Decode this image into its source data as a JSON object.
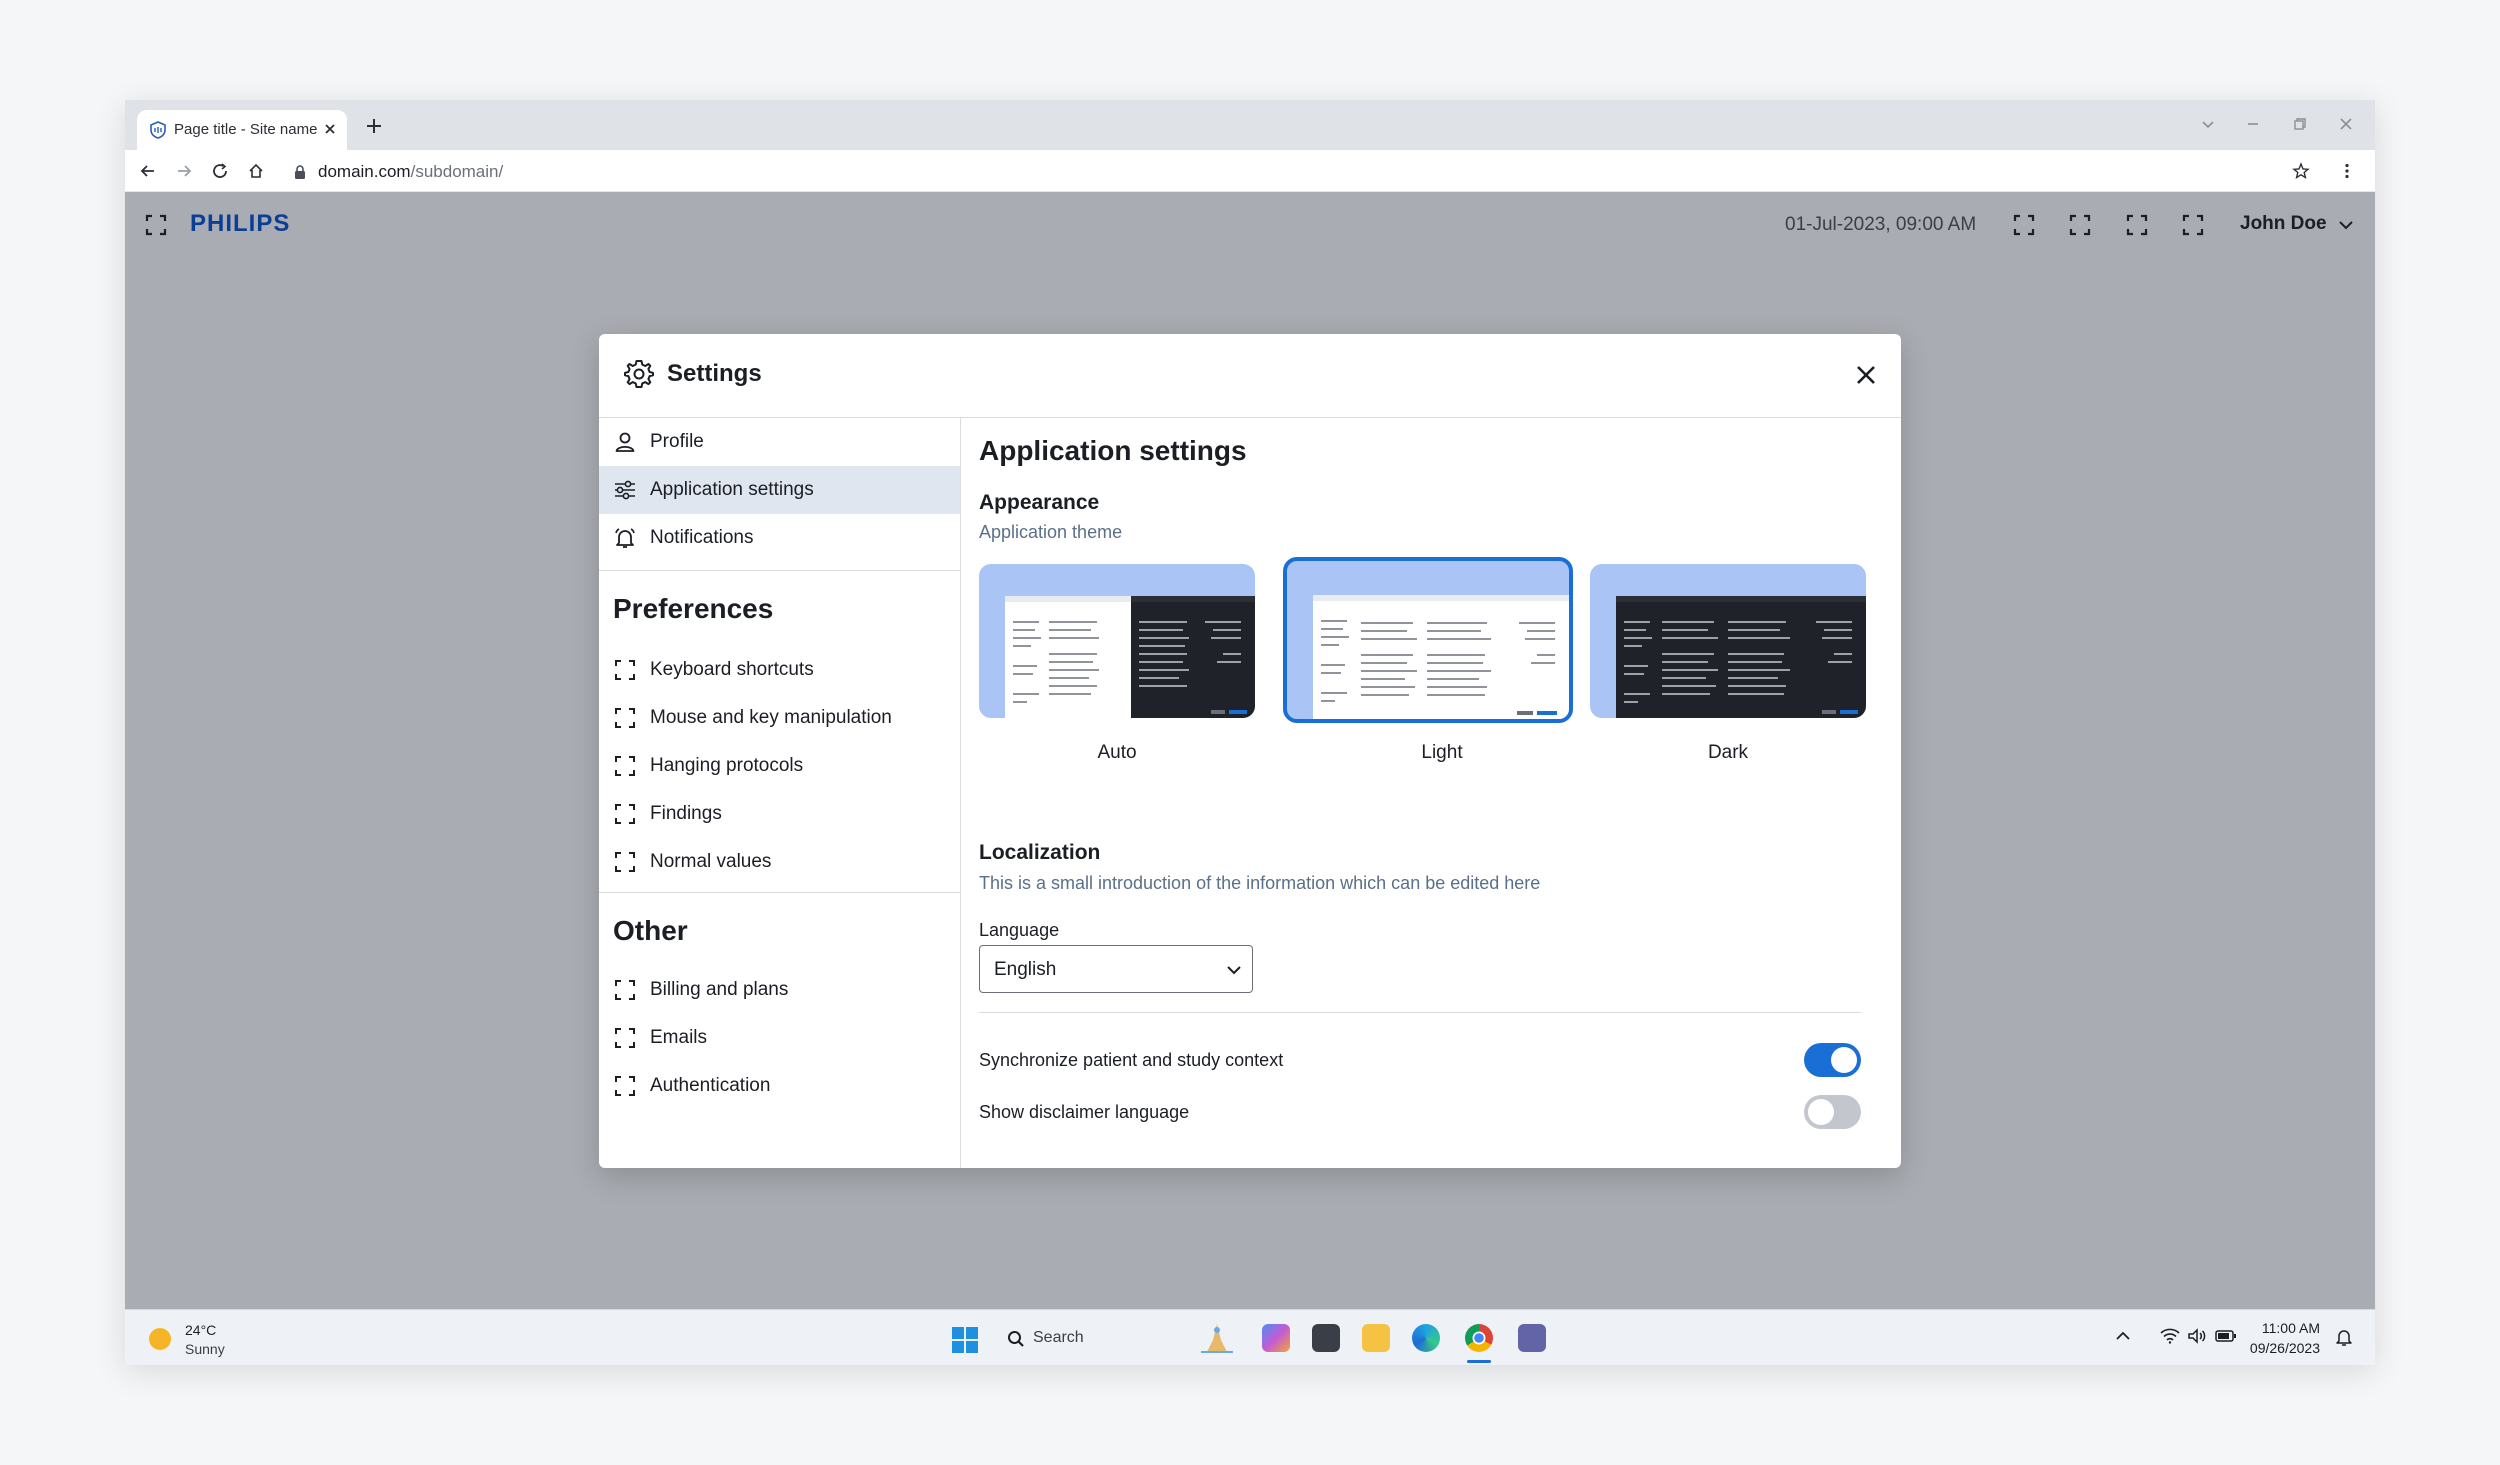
{
  "browser": {
    "tab_title": "Page title - Site name",
    "url_domain": "domain.com",
    "url_path": "/subdomain/"
  },
  "app": {
    "logo": "PHILIPS",
    "datetime": "01-Jul-2023, 09:00 AM",
    "user_name": "John Doe"
  },
  "modal": {
    "title": "Settings",
    "nav_top": [
      {
        "label": "Profile",
        "icon": "person-icon"
      },
      {
        "label": "Application settings",
        "icon": "sliders-icon",
        "active": true
      },
      {
        "label": "Notifications",
        "icon": "bell-icon"
      }
    ],
    "preferences_heading": "Preferences",
    "preferences": [
      {
        "label": "Keyboard shortcuts"
      },
      {
        "label": "Mouse and key manipulation"
      },
      {
        "label": "Hanging protocols"
      },
      {
        "label": "Findings"
      },
      {
        "label": "Normal values"
      }
    ],
    "other_heading": "Other",
    "other": [
      {
        "label": "Billing and plans"
      },
      {
        "label": "Emails"
      },
      {
        "label": "Authentication"
      }
    ],
    "content": {
      "title": "Application settings",
      "appearance": {
        "title": "Appearance",
        "subtitle": "Application theme",
        "themes": [
          {
            "label": "Auto",
            "selected": false
          },
          {
            "label": "Light",
            "selected": true
          },
          {
            "label": "Dark",
            "selected": false
          }
        ]
      },
      "localization": {
        "title": "Localization",
        "subtitle": "This is a small introduction of the information which can be edited here",
        "language_label": "Language",
        "language_value": "English"
      },
      "toggles": [
        {
          "label": "Synchronize patient and study context",
          "on": true
        },
        {
          "label": "Show disclaimer language",
          "on": false
        }
      ]
    }
  },
  "taskbar": {
    "weather_temp": "24°C",
    "weather_cond": "Sunny",
    "search_placeholder": "Search",
    "time": "11:00 AM",
    "date": "09/26/2023"
  },
  "colors": {
    "accent": "#1a6fd6",
    "brand": "#0b3f96",
    "app_bg": "#a9acb2",
    "nav_active": "#dfe6f0"
  }
}
